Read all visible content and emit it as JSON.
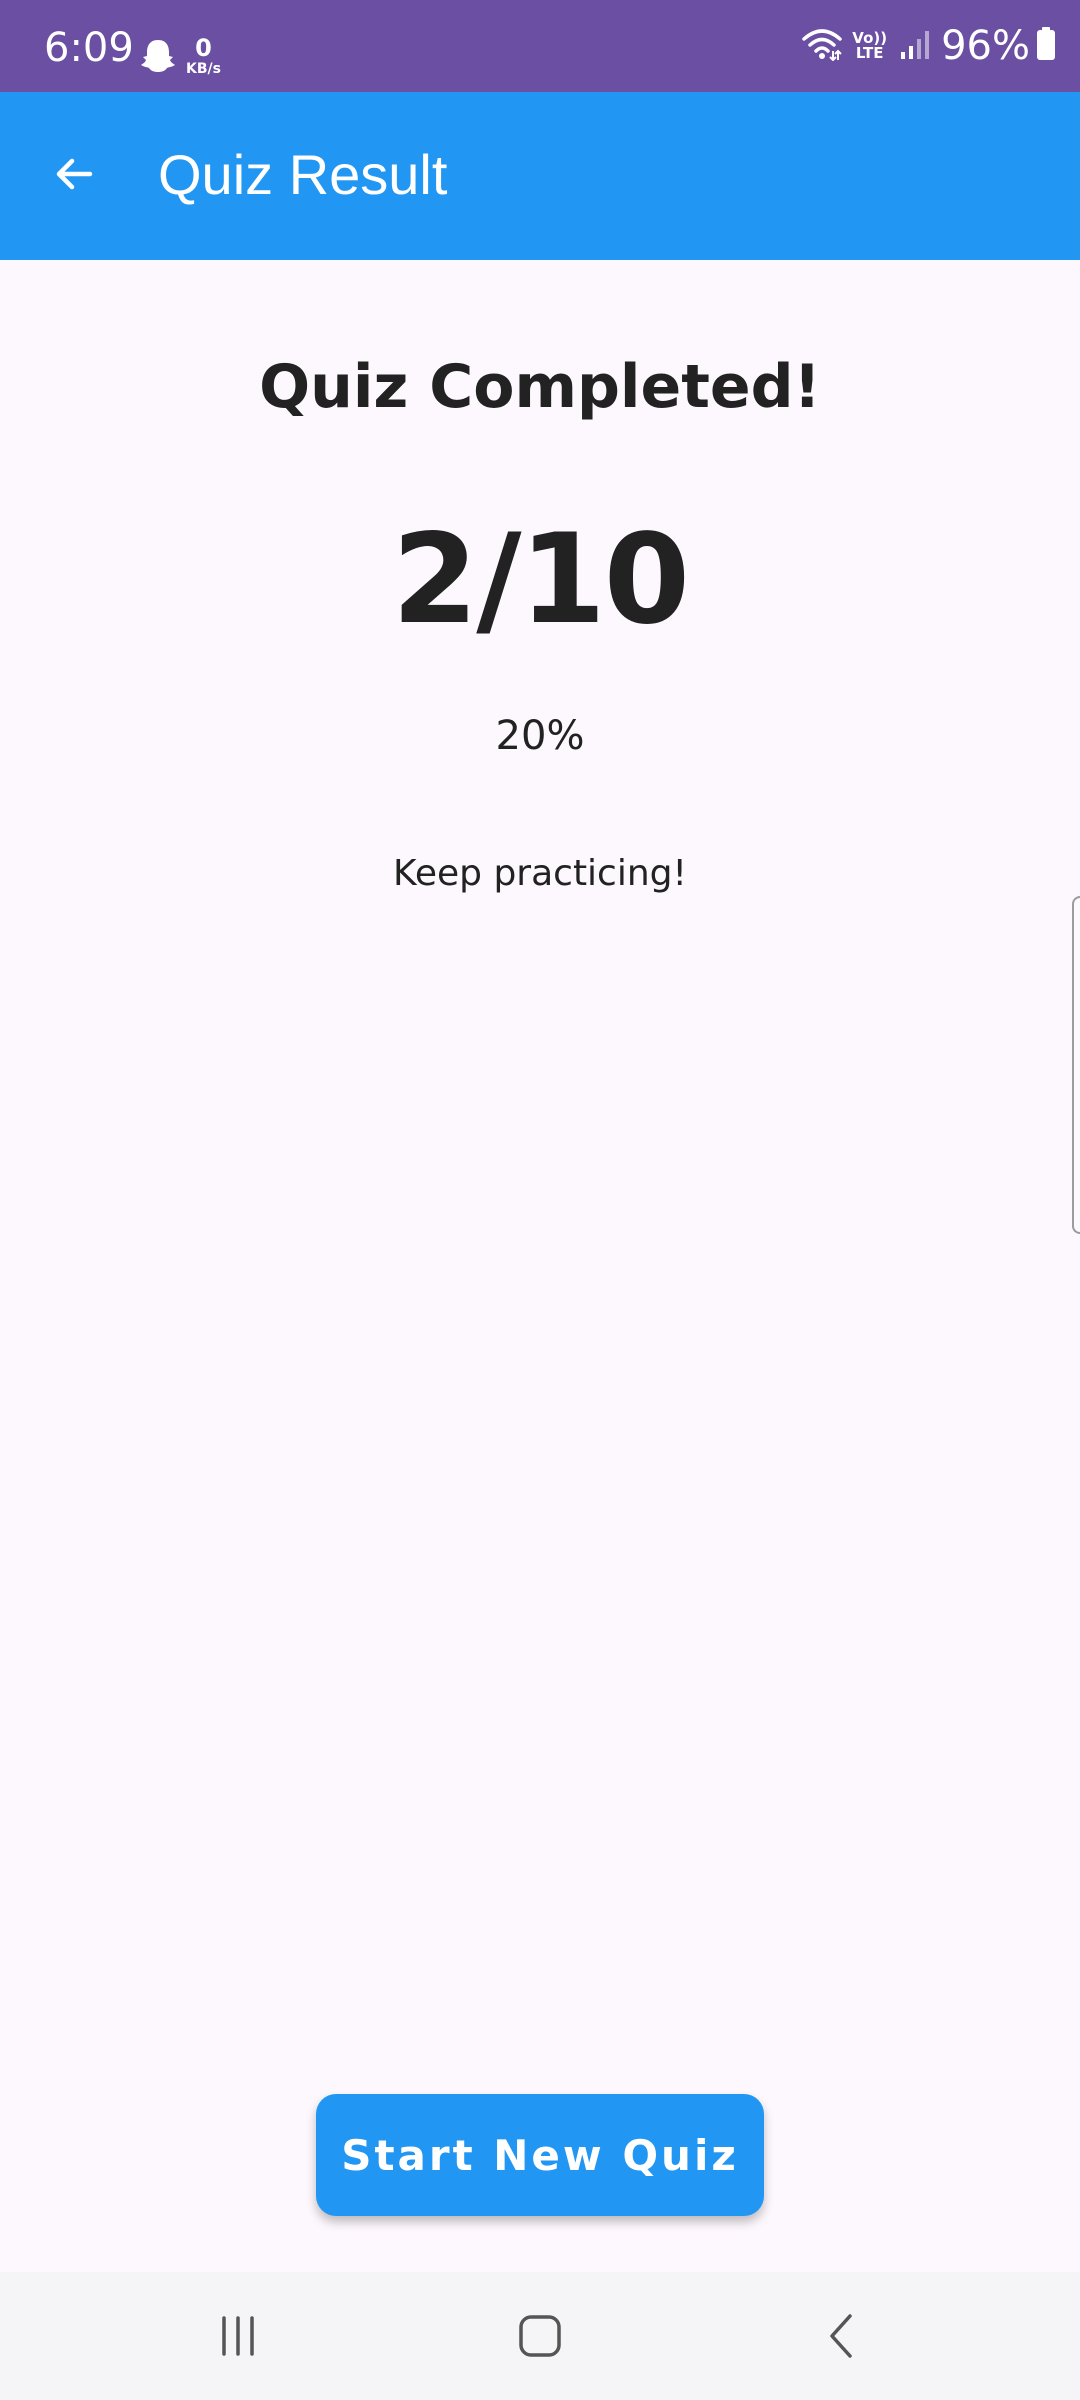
{
  "status_bar": {
    "time": "6:09",
    "speed_value": "0",
    "speed_unit": "KB/s",
    "network_line1": "Vo))",
    "network_line2": "LTE",
    "battery": "96%",
    "background_color": "#6a4fa3"
  },
  "app_bar": {
    "title": "Quiz Result",
    "back_icon": "arrow-left-icon",
    "background_color": "#2196f3"
  },
  "result": {
    "heading": "Quiz Completed!",
    "score": "2/10",
    "percentage": "20%",
    "message": "Keep practicing!"
  },
  "actions": {
    "start_new_quiz_label": "Start New Quiz",
    "button_color": "#2196f3"
  },
  "nav_bar": {
    "recents_icon": "recents-icon",
    "home_icon": "home-icon",
    "back_icon": "back-chevron-icon"
  }
}
